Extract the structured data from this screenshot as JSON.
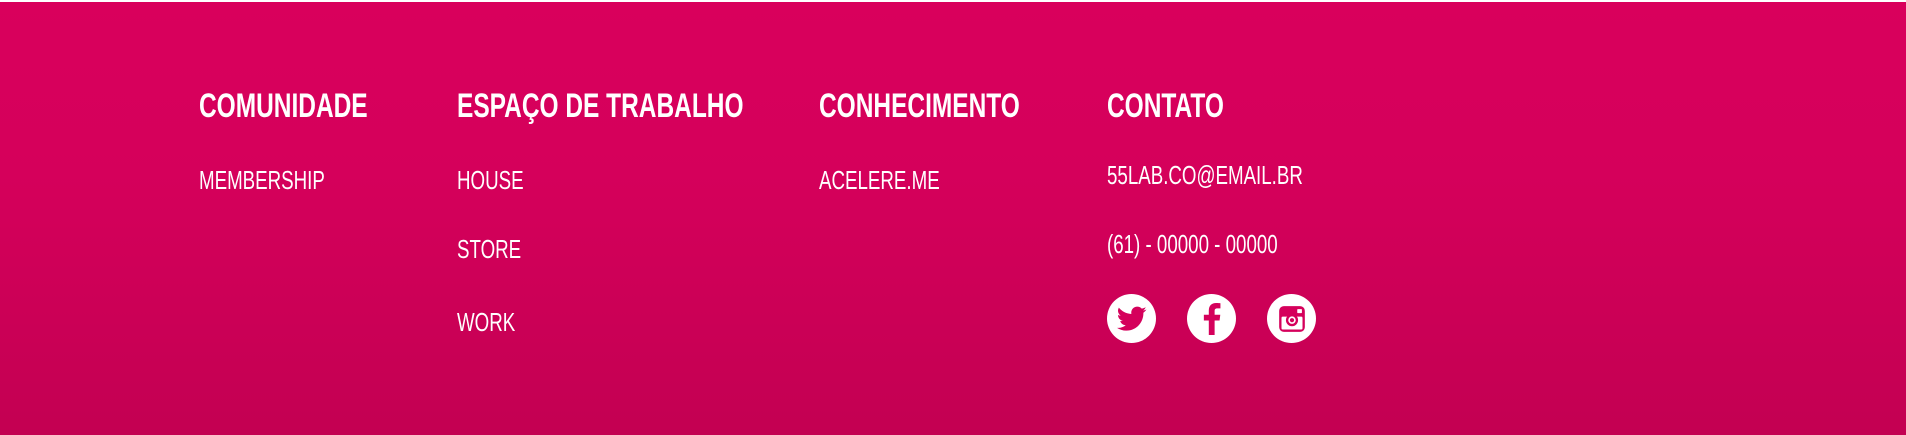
{
  "footer": {
    "columns": [
      {
        "heading": "COMUNIDADE",
        "links": [
          "MEMBERSHIP"
        ]
      },
      {
        "heading": "ESPAÇO DE TRABALHO",
        "links": [
          "HOUSE",
          "STORE",
          "WORK"
        ]
      },
      {
        "heading": "CONHECIMENTO",
        "links": [
          "ACELERE.ME"
        ]
      }
    ],
    "contact": {
      "heading": "CONTATO",
      "email": "55LAB.CO@EMAIL.BR",
      "phone": "(61) - 00000 - 00000"
    },
    "social": [
      {
        "name": "twitter",
        "icon": "twitter-icon"
      },
      {
        "name": "facebook",
        "icon": "facebook-icon"
      },
      {
        "name": "instagram",
        "icon": "instagram-icon"
      }
    ],
    "colors": {
      "background_top": "#d9005c",
      "background_bottom": "#c30052",
      "text": "#ffffff"
    }
  }
}
